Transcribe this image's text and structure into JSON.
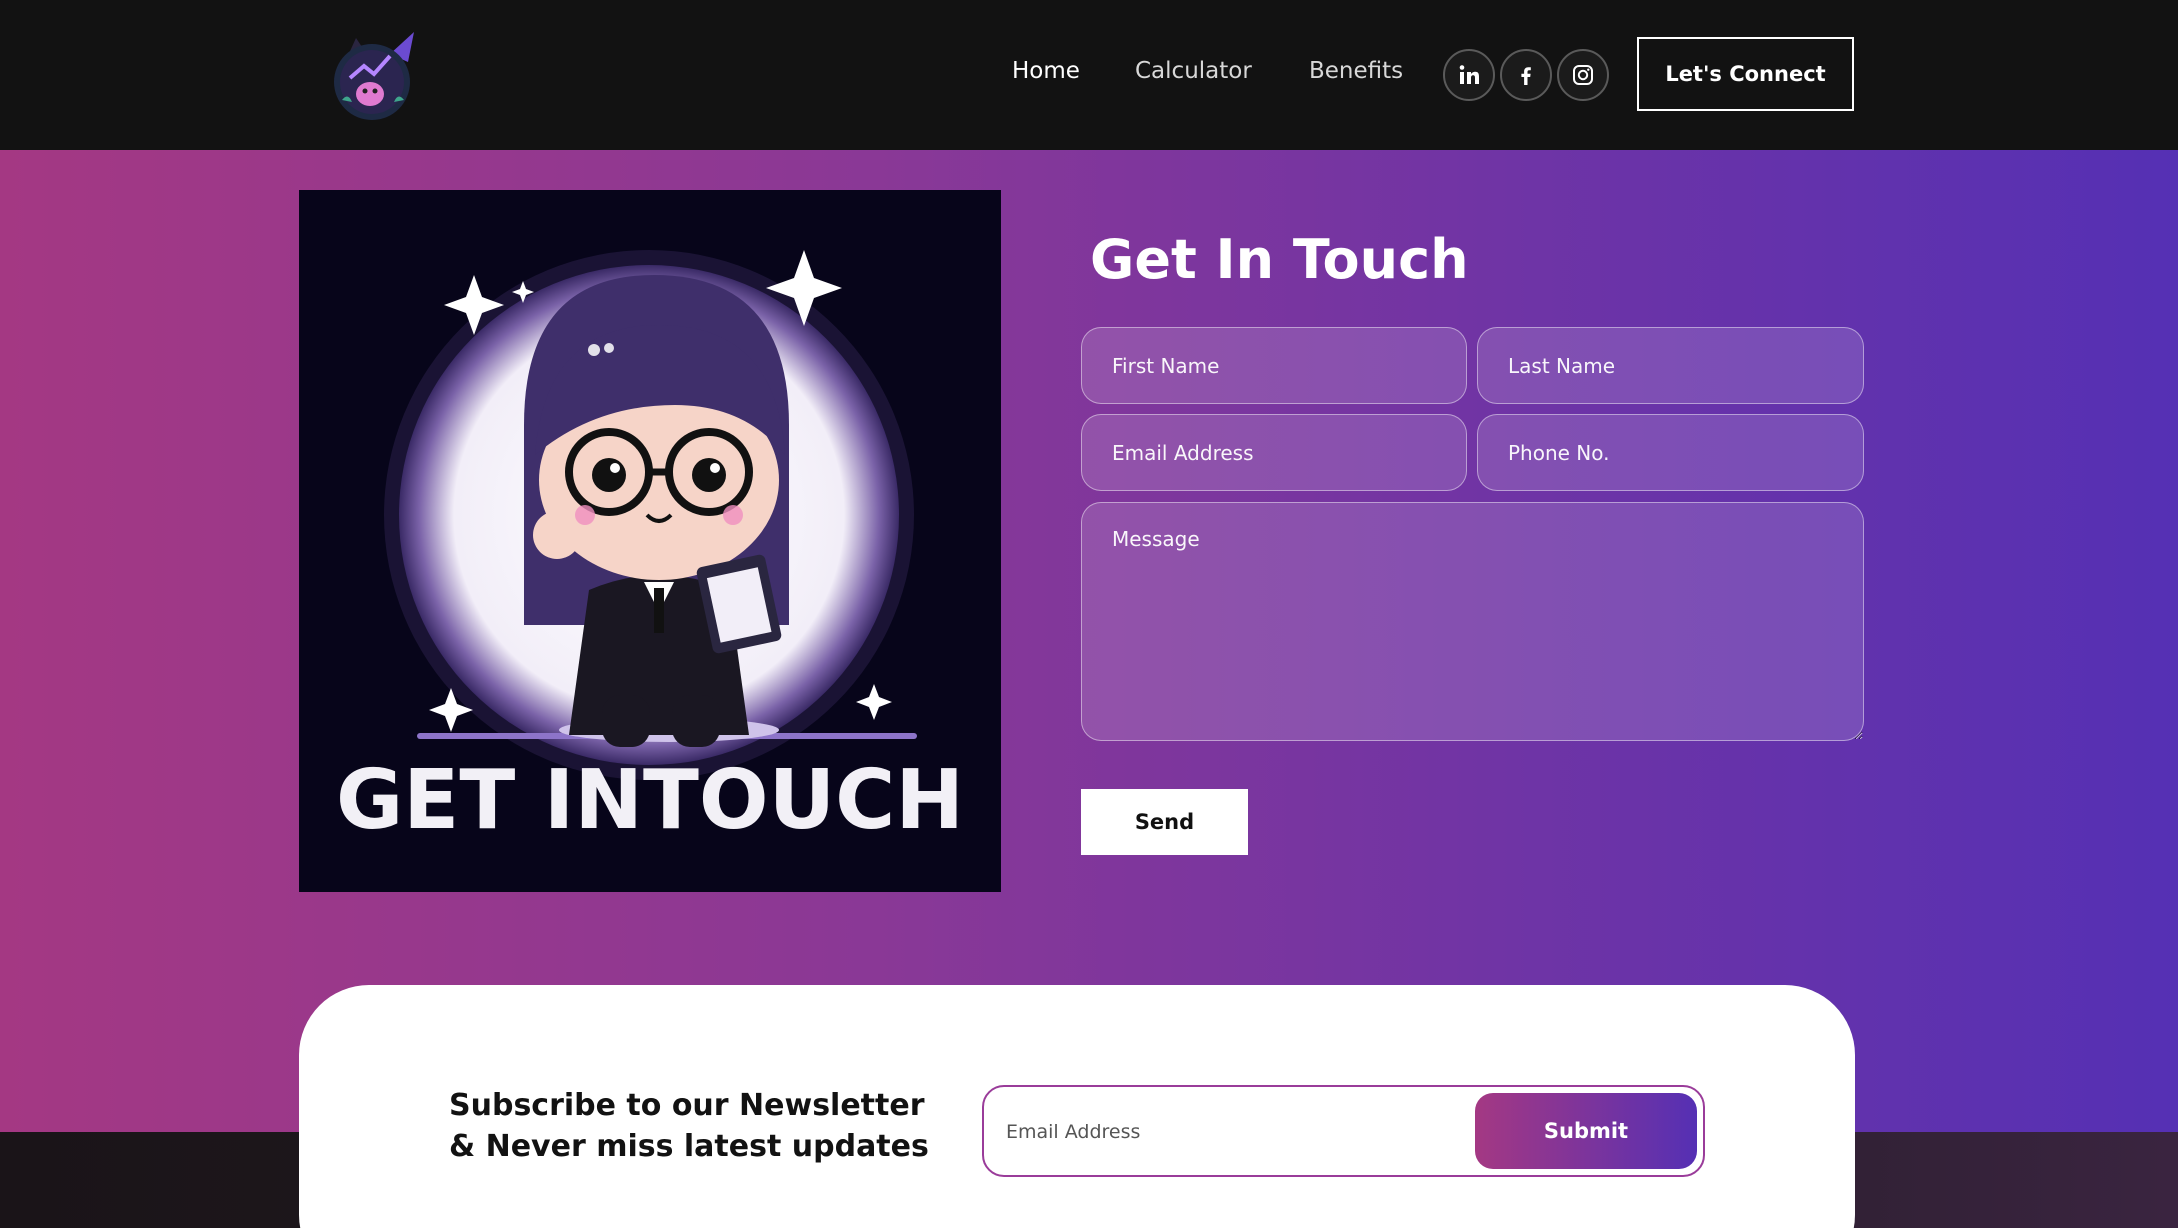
{
  "header": {
    "logo_icon": "cat-chart-logo-icon",
    "nav": [
      {
        "label": "Home",
        "active": true
      },
      {
        "label": "Calculator",
        "active": false
      },
      {
        "label": "Benefits",
        "active": false
      }
    ],
    "socials": [
      {
        "icon": "linkedin-icon"
      },
      {
        "icon": "facebook-icon"
      },
      {
        "icon": "instagram-icon"
      }
    ],
    "cta_label": "Let's Connect"
  },
  "hero": {
    "illustration_text": "GET INTOUCH",
    "form": {
      "title": "Get In Touch",
      "first_name_placeholder": "First Name",
      "last_name_placeholder": "Last Name",
      "email_placeholder": "Email Address",
      "phone_placeholder": "Phone No.",
      "message_placeholder": "Message",
      "send_label": "Send"
    }
  },
  "newsletter": {
    "heading_line1": "Subscribe to our Newsletter",
    "heading_line2": "& Never miss latest updates",
    "email_placeholder": "Email Address",
    "submit_label": "Submit"
  },
  "colors": {
    "gradient_start": "#a43883",
    "gradient_end": "#5530b4",
    "header_bg": "#121212",
    "card_bg": "#ffffff"
  }
}
